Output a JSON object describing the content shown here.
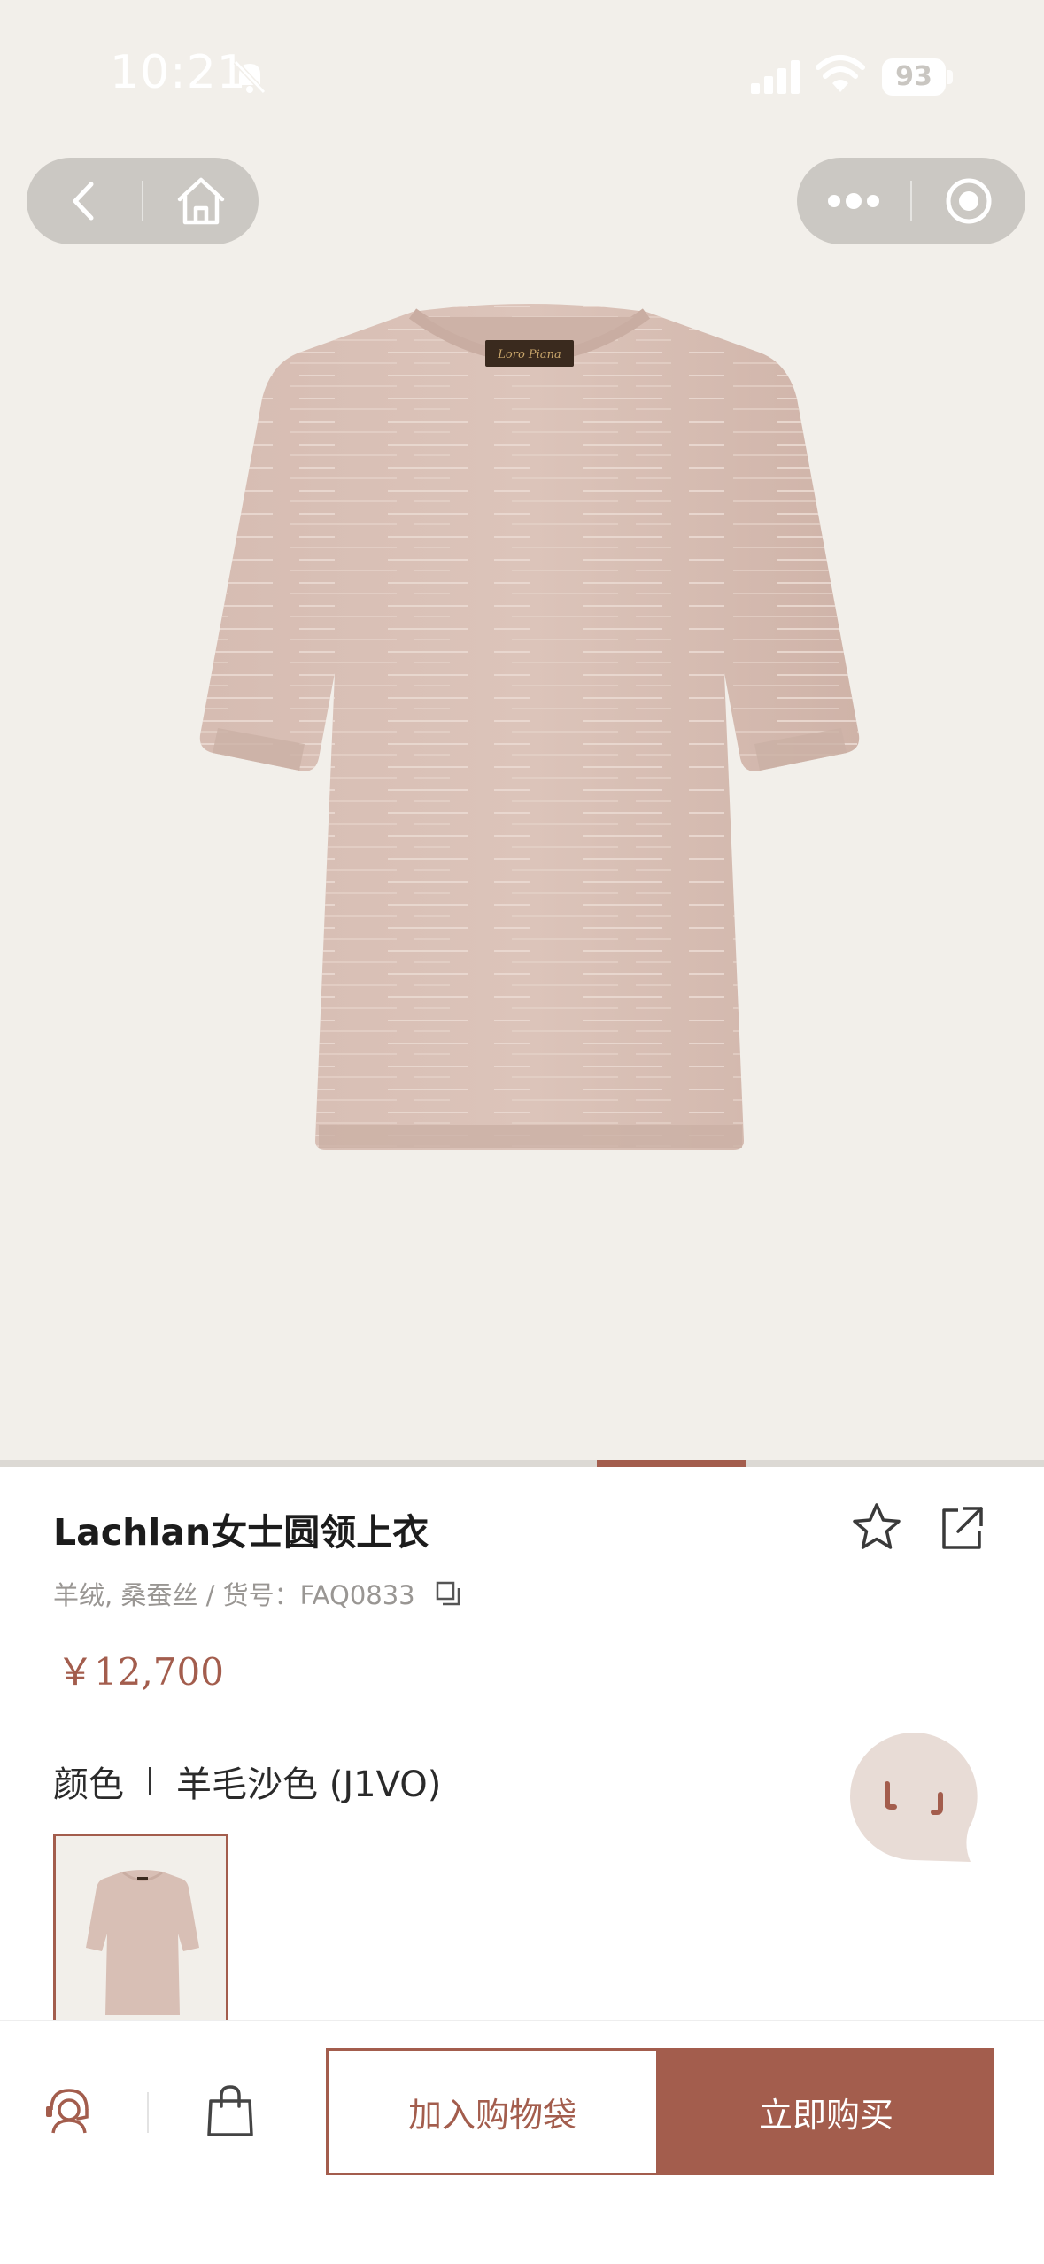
{
  "status_bar": {
    "time": "10:21",
    "battery": "93",
    "icons": [
      "bell-off-icon",
      "signal-icon",
      "wifi-icon",
      "battery-icon"
    ]
  },
  "mini_program_nav": {
    "left": [
      "back-icon",
      "home-icon"
    ],
    "right": [
      "more-icon",
      "close-target-icon"
    ]
  },
  "carousel": {
    "current_fraction_start": 0.572,
    "current_fraction_end": 0.714
  },
  "product": {
    "title": "Lachlan女士圆领上衣",
    "material_and_sku": "羊绒, 桑蚕丝 / 货号：FAQ0833",
    "price": "￥12,700",
    "color_label": "颜色",
    "color_value": "羊毛沙色 (J1VO)",
    "image_color": "#d8bfb5",
    "selected_swatch": 0
  },
  "actions": {
    "favorite_icon": "star-icon",
    "share_icon": "share-icon",
    "copy_icon": "copy-icon",
    "chat_icon": "chat-bubble-icon"
  },
  "bottom_bar": {
    "service_icon": "customer-service-icon",
    "bag_icon": "shopping-bag-icon",
    "add_to_cart": "加入购物袋",
    "buy_now": "立即购买"
  },
  "colors": {
    "accent": "#a35d4d",
    "hero_bg": "#f2efea",
    "text_muted": "#999693"
  }
}
